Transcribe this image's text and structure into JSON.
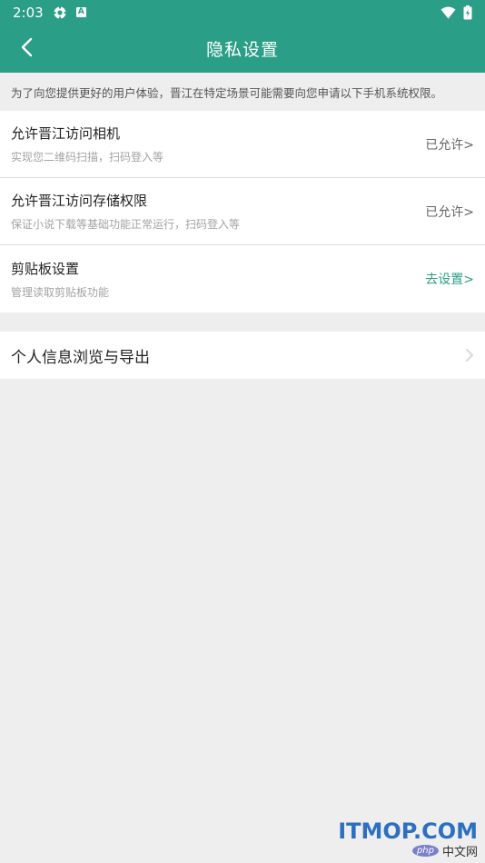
{
  "status_bar": {
    "time": "2:03",
    "icons": [
      "settings-gear-icon",
      "a-letter-icon",
      "wifi-icon",
      "battery-icon"
    ]
  },
  "header": {
    "title": "隐私设置",
    "back_icon": "chevron-left-icon"
  },
  "notice": "为了向您提供更好的用户体验，晋江在特定场景可能需要向您申请以下手机系统权限。",
  "permissions": [
    {
      "title": "允许晋江访问相机",
      "subtitle": "实现您二维码扫描，扫码登入等",
      "status": "已允许>"
    },
    {
      "title": "允许晋江访问存储权限",
      "subtitle": "保证小说下载等基础功能正常运行，扫码登入等",
      "status": "已允许>"
    },
    {
      "title": "剪贴板设置",
      "subtitle": "管理读取剪贴板功能",
      "status": "去设置>"
    }
  ],
  "personal_info": {
    "title": "个人信息浏览与导出",
    "icon": "chevron-right-icon"
  },
  "watermark": {
    "top": "ITMOP.COM",
    "badge": "php",
    "cn": "中文网"
  },
  "colors": {
    "brand": "#2a9e86",
    "background": "#efeeef",
    "status_green": "#2a9e86",
    "watermark_blue": "#2d6fc0"
  }
}
